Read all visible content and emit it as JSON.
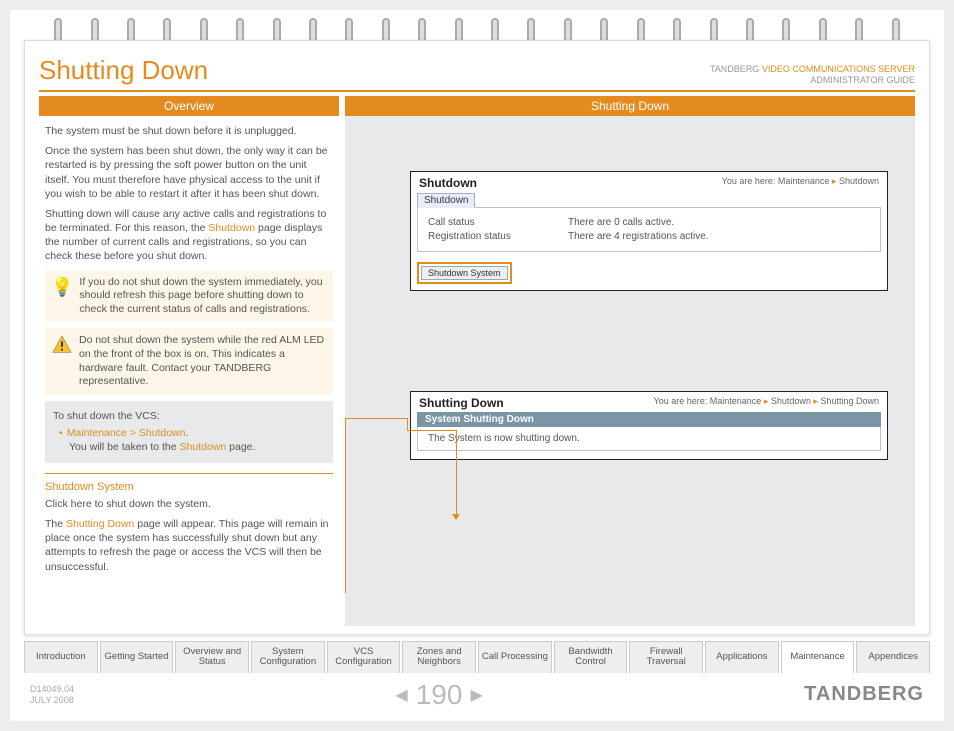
{
  "header": {
    "title": "Shutting Down",
    "brand_prefix": "TANDBERG ",
    "brand_product": "VIDEO COMMUNICATIONS SERVER",
    "guide": "ADMINISTRATOR GUIDE"
  },
  "columns": {
    "left_title": "Overview",
    "right_title": "Shutting Down"
  },
  "overview": {
    "p1": "The system must be shut down before it is unplugged.",
    "p2": "Once the system has been shut down, the only way it can be restarted is by pressing the soft power button on the unit itself. You must therefore have physical access to the unit if you wish to be able to restart it after it has been shut down.",
    "p3a": "Shutting down will cause any active calls and registrations to be terminated.  For this reason, the ",
    "p3link": "Shutdown",
    "p3b": " page displays the number of current calls and registrations, so you can check these before you shut down.",
    "note": "If you do not shut down the system immediately, you should refresh this page before shutting down to check the current status of calls and registrations.",
    "warn": "Do not shut down the system while the red ALM LED on the front of the box is on.  This indicates a hardware fault.  Contact your TANDBERG representative.",
    "steps_title": "To shut down the VCS:",
    "step1a": "Maintenance > Shutdown",
    "step1b": ".",
    "step2a": "You will be taken to the ",
    "step2link": "Shutdown",
    "step2b": " page.",
    "sec_head": "Shutdown System",
    "sec1": "Click here to shut down the system.",
    "sec2a": "The ",
    "sec2link": "Shutting Down",
    "sec2b": " page will appear.  This page will remain in place once the system has successfully shut down but any attempts to refresh the page or access the VCS will then be unsuccessful."
  },
  "panel1": {
    "title": "Shutdown",
    "crumb_prefix": "You are here: ",
    "crumb1": "Maintenance",
    "crumb2": "Shutdown",
    "tab": "Shutdown",
    "call_label": "Call status",
    "call_value": "There are 0 calls active.",
    "reg_label": "Registration status",
    "reg_value": "There are 4 registrations active.",
    "button": "Shutdown System"
  },
  "panel2": {
    "title": "Shutting Down",
    "crumb_prefix": "You are here: ",
    "crumb1": "Maintenance",
    "crumb2": "Shutdown",
    "crumb3": "Shutting Down",
    "bar": "System Shutting Down",
    "msg": "The System is now shutting down."
  },
  "tabs": [
    "Introduction",
    "Getting Started",
    "Overview and Status",
    "System Configuration",
    "VCS Configuration",
    "Zones and Neighbors",
    "Call Processing",
    "Bandwidth Control",
    "Firewall Traversal",
    "Applications",
    "Maintenance",
    "Appendices"
  ],
  "active_tab": "Maintenance",
  "footer": {
    "docid": "D14049.04",
    "date": "JULY 2008",
    "page": "190",
    "brand": "TANDBERG"
  }
}
